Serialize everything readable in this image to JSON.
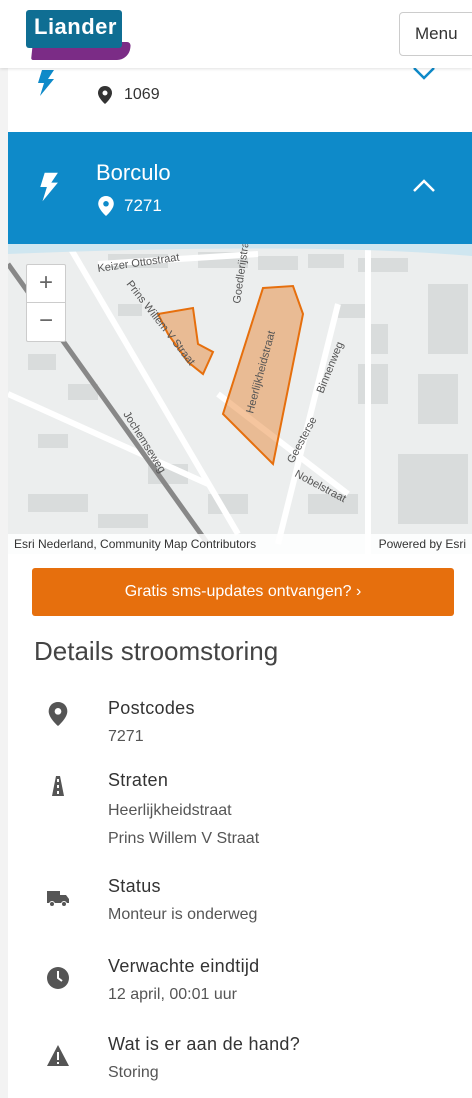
{
  "header": {
    "logo_text": "Liander",
    "menu_label": "Menu"
  },
  "collapsed_item": {
    "zip": "1069",
    "icon": "lightning-icon"
  },
  "open_item": {
    "title": "Borculo",
    "zip": "7271",
    "icon": "lightning-icon"
  },
  "map": {
    "zoom_in": "+",
    "zoom_out": "−",
    "attribution_left": "Esri Nederland, Community Map Contributors",
    "attribution_right": "Powered by Esri",
    "street_labels": [
      "Keizer Ottostraat",
      "Prins Willem V Straat",
      "Goedlerijstraat",
      "Heerlijkheidstraat",
      "Binnenweg",
      "Jochemseweg",
      "Geesterse",
      "Nobelstraat"
    ]
  },
  "sms_button": "Gratis sms-updates ontvangen? ›",
  "details": {
    "title": "Details stroomstoring",
    "postcodes": {
      "label": "Postcodes",
      "values": [
        "7271"
      ]
    },
    "straten": {
      "label": "Straten",
      "values": [
        "Heerlijkheidstraat",
        "Prins Willem V Straat"
      ]
    },
    "status": {
      "label": "Status",
      "values": [
        "Monteur is onderweg"
      ]
    },
    "eindtijd": {
      "label": "Verwachte eindtijd",
      "values": [
        "12 april, 00:01 uur"
      ]
    },
    "oorzaak": {
      "label": "Wat is er aan de hand?",
      "values": [
        "Storing"
      ]
    }
  },
  "colors": {
    "blue": "#0e8ac9",
    "orange": "#e66f0d",
    "logo_blue": "#0f6e93",
    "logo_purple": "#7b2c86"
  }
}
